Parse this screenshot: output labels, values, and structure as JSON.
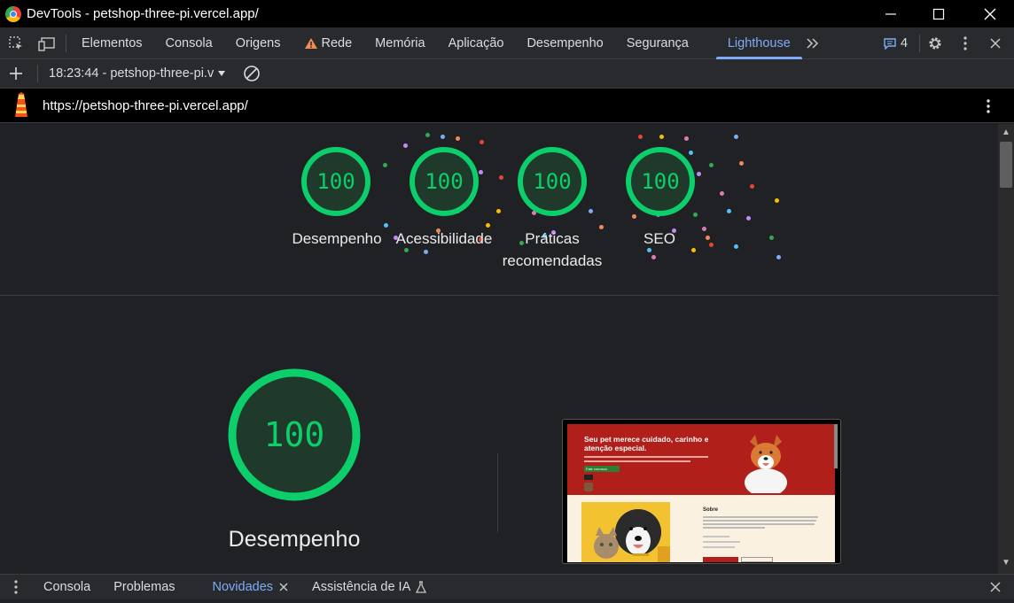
{
  "window": {
    "title": "DevTools - petshop-three-pi.vercel.app/"
  },
  "tabs": [
    {
      "label": "Elementos"
    },
    {
      "label": "Consola"
    },
    {
      "label": "Origens"
    },
    {
      "label": "Rede",
      "warning": true
    },
    {
      "label": "Memória"
    },
    {
      "label": "Aplicação"
    },
    {
      "label": "Desempenho"
    },
    {
      "label": "Segurança"
    },
    {
      "label": "Lighthouse",
      "active": true
    }
  ],
  "issues_count": "4",
  "toolbar": {
    "report_selector": "18:23:44 - petshop-three-pi.v"
  },
  "url": "https://petshop-three-pi.vercel.app/",
  "scores": [
    {
      "value": "100",
      "label": "Desempenho"
    },
    {
      "value": "100",
      "label": "Acessibilidade"
    },
    {
      "value": "100",
      "label": "Práticas recomendadas"
    },
    {
      "value": "100",
      "label": "SEO"
    }
  ],
  "main_score": {
    "value": "100",
    "label": "Desempenho"
  },
  "screenshot": {
    "hero_title": "Seu pet merece cuidado, carinho e atenção especial.",
    "hero_cta": "Fale conosco",
    "section_title": "Sobre"
  },
  "drawer_tabs": [
    {
      "label": "Consola"
    },
    {
      "label": "Problemas"
    },
    {
      "label": "Novidades",
      "active": true
    },
    {
      "label": "Assistência de IA"
    }
  ],
  "colors": {
    "score_green": "#0cce6b",
    "gauge_fill": "#1f3a2a",
    "accent": "#7cacf8",
    "warning": "#f28b54"
  }
}
